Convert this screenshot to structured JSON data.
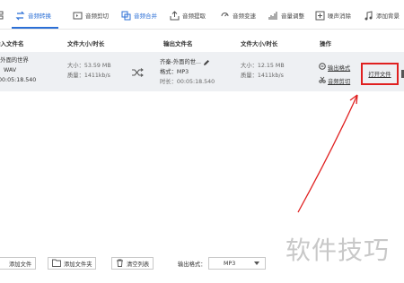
{
  "toolbar": {
    "items": [
      {
        "label": "",
        "icon": "grid-icon"
      },
      {
        "label": "音频转换",
        "icon": "convert-icon"
      },
      {
        "label": "音频剪切",
        "icon": "cut-icon"
      },
      {
        "label": "音频合并",
        "icon": "merge-icon"
      },
      {
        "label": "音频提取",
        "icon": "extract-icon"
      },
      {
        "label": "音频变速",
        "icon": "speed-icon"
      },
      {
        "label": "音量调整",
        "icon": "volume-icon"
      },
      {
        "label": "噪声消除",
        "icon": "denoise-icon"
      },
      {
        "label": "添加背景",
        "icon": "music-note-icon"
      }
    ],
    "accent": "#2b6fd6"
  },
  "table": {
    "headers": [
      "输入文件名",
      "文件大小/时长",
      "输出文件名",
      "文件大小/时长",
      "操作"
    ],
    "row": {
      "input_name": "-外面的世界",
      "input_format": "WAV",
      "input_duration": "00:05:18.540",
      "input_size": "大小：53.59 MB",
      "input_quality": "质量：1411kb/s",
      "output_name": "齐秦-外面的世...",
      "output_format_label": "格式：",
      "output_format": "MP3",
      "output_duration": "时长：00:05:18.540",
      "output_size": "大小：12.15 MB",
      "output_quality": "质量：1411kb/s",
      "op_output_format": "输出格式",
      "op_cut": "音频剪切",
      "op_open": "打开文件"
    }
  },
  "bottom": {
    "add_file": "添加文件",
    "add_folder": "添加文件夹",
    "clear_list": "清空列表",
    "output_format_label": "输出格式：",
    "output_format_value": "MP3"
  },
  "watermark": "软件技巧",
  "highlight_color": "#e02020"
}
